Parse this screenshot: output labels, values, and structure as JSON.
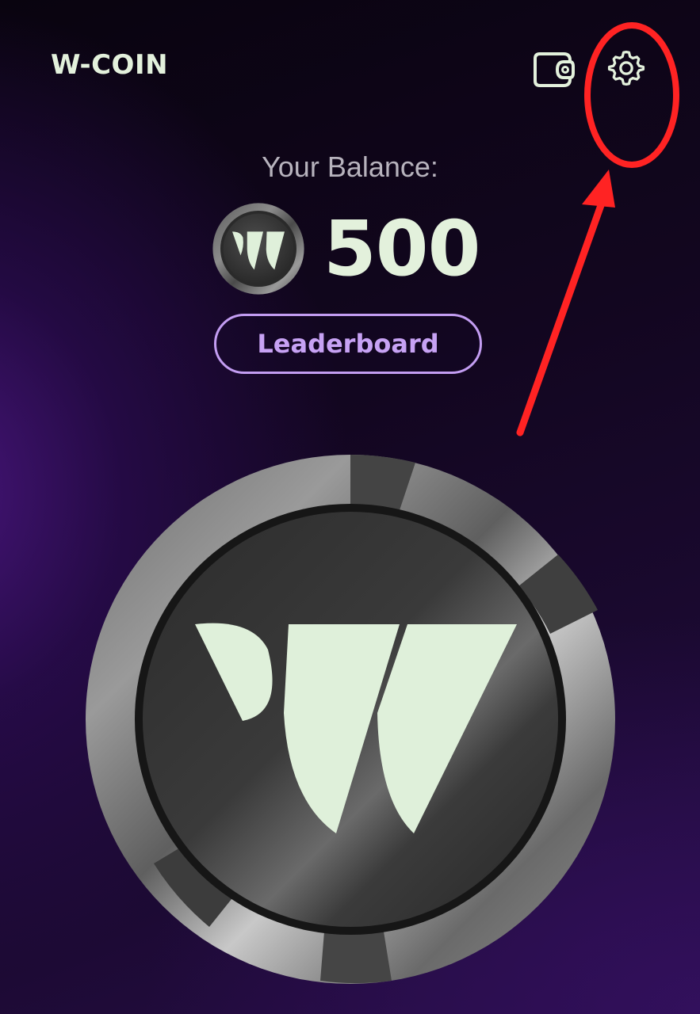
{
  "header": {
    "app_title": "W-COIN",
    "wallet_icon": "wallet-icon",
    "settings_icon": "gear-icon"
  },
  "balance": {
    "label": "Your Balance:",
    "value": "500",
    "coin_icon": "w-coin-icon"
  },
  "leaderboard": {
    "label": "Leaderboard"
  },
  "tap_coin": {
    "icon": "w-coin-icon"
  },
  "colors": {
    "accent_text": "#e3f1dc",
    "leaderboard_purple": "#c39df2",
    "annotation_red": "#ff2323",
    "background_dark": "#0a0410",
    "background_purple": "#3a1470"
  }
}
